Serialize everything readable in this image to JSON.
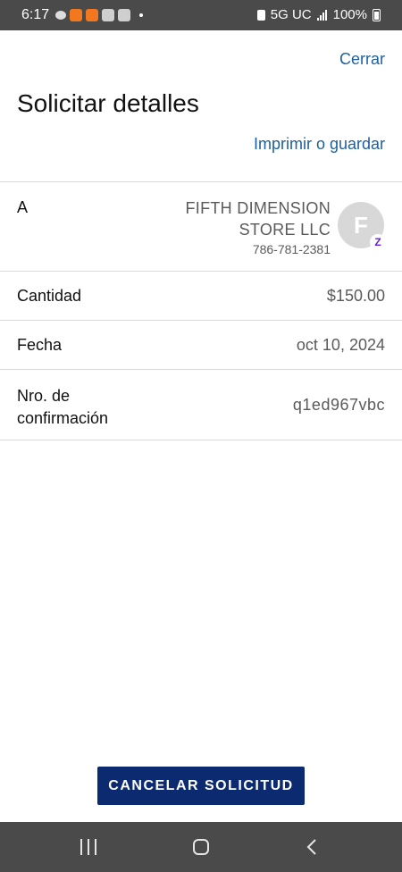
{
  "status_bar": {
    "time": "6:17",
    "network": "5G UC",
    "battery": "100%",
    "notification_icons": [
      "message-icon",
      "temu-icon",
      "temu-icon",
      "photo-icon",
      "photo-icon",
      "dot-icon"
    ]
  },
  "header": {
    "close_label": "Cerrar",
    "title": "Solicitar detalles",
    "print_label": "Imprimir o guardar"
  },
  "details": {
    "to": {
      "label": "A",
      "name_line1": "FIFTH DIMENSION",
      "name_line2": "STORE LLC",
      "phone": "786-781-2381",
      "avatar_initial": "F",
      "badge_symbol": "Z"
    },
    "amount": {
      "label": "Cantidad",
      "value": "$150.00"
    },
    "date": {
      "label": "Fecha",
      "value": "oct 10, 2024"
    },
    "confirmation": {
      "label_line1": "Nro. de",
      "label_line2": "confirmación",
      "value": "q1ed967vbc"
    }
  },
  "actions": {
    "cancel_label": "CANCELAR SOLICITUD"
  },
  "colors": {
    "link": "#1f5f9c",
    "primary_button": "#0b2a6f",
    "zelle_purple": "#6d1ed4"
  }
}
